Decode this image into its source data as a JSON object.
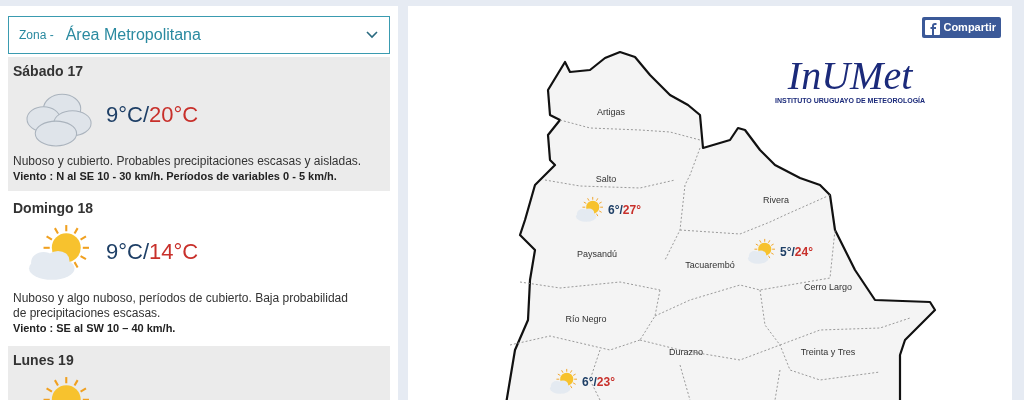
{
  "zone": {
    "label": "Zona -",
    "value": "Área Metropolitana"
  },
  "days": [
    {
      "day": "Sábado 17",
      "kind": "cloudy",
      "min": "9°C",
      "separator": "/",
      "max": "20°C",
      "description": "Nuboso y cubierto. Probables precipitaciones escasas y aisladas.",
      "wind": "Viento : N al SE 10 - 30 km/h. Períodos de variables 0 - 5 km/h."
    },
    {
      "day": "Domingo 18",
      "kind": "sun_cloud",
      "min": "9°C",
      "separator": "/",
      "max": "14°C",
      "description": "Nuboso y algo nuboso, períodos de cubierto. Baja probabilidad de precipitaciones escasas.",
      "wind": "Viento : SE al SW 10 – 40 km/h."
    },
    {
      "day": "Lunes 19",
      "kind": "sun_cloud"
    }
  ],
  "share_button": "Compartir",
  "logo": {
    "name": "InUMet",
    "subtitle": "INSTITUTO URUGUAYO DE METEOROLOGÍA"
  },
  "departments": [
    "Artigas",
    "Salto",
    "Rivera",
    "Paysandú",
    "Tacuarembó",
    "Cerro Largo",
    "Río Negro",
    "Durazno",
    "Treinta y Tres"
  ],
  "map_forecasts": [
    {
      "kind": "sun_cloud",
      "min": "6°",
      "separator": "/",
      "max": "27°"
    },
    {
      "kind": "sun_cloud",
      "min": "5°",
      "separator": "/",
      "max": "24°"
    },
    {
      "kind": "sun_cloud",
      "min": "6°",
      "separator": "/",
      "max": "23°"
    }
  ]
}
